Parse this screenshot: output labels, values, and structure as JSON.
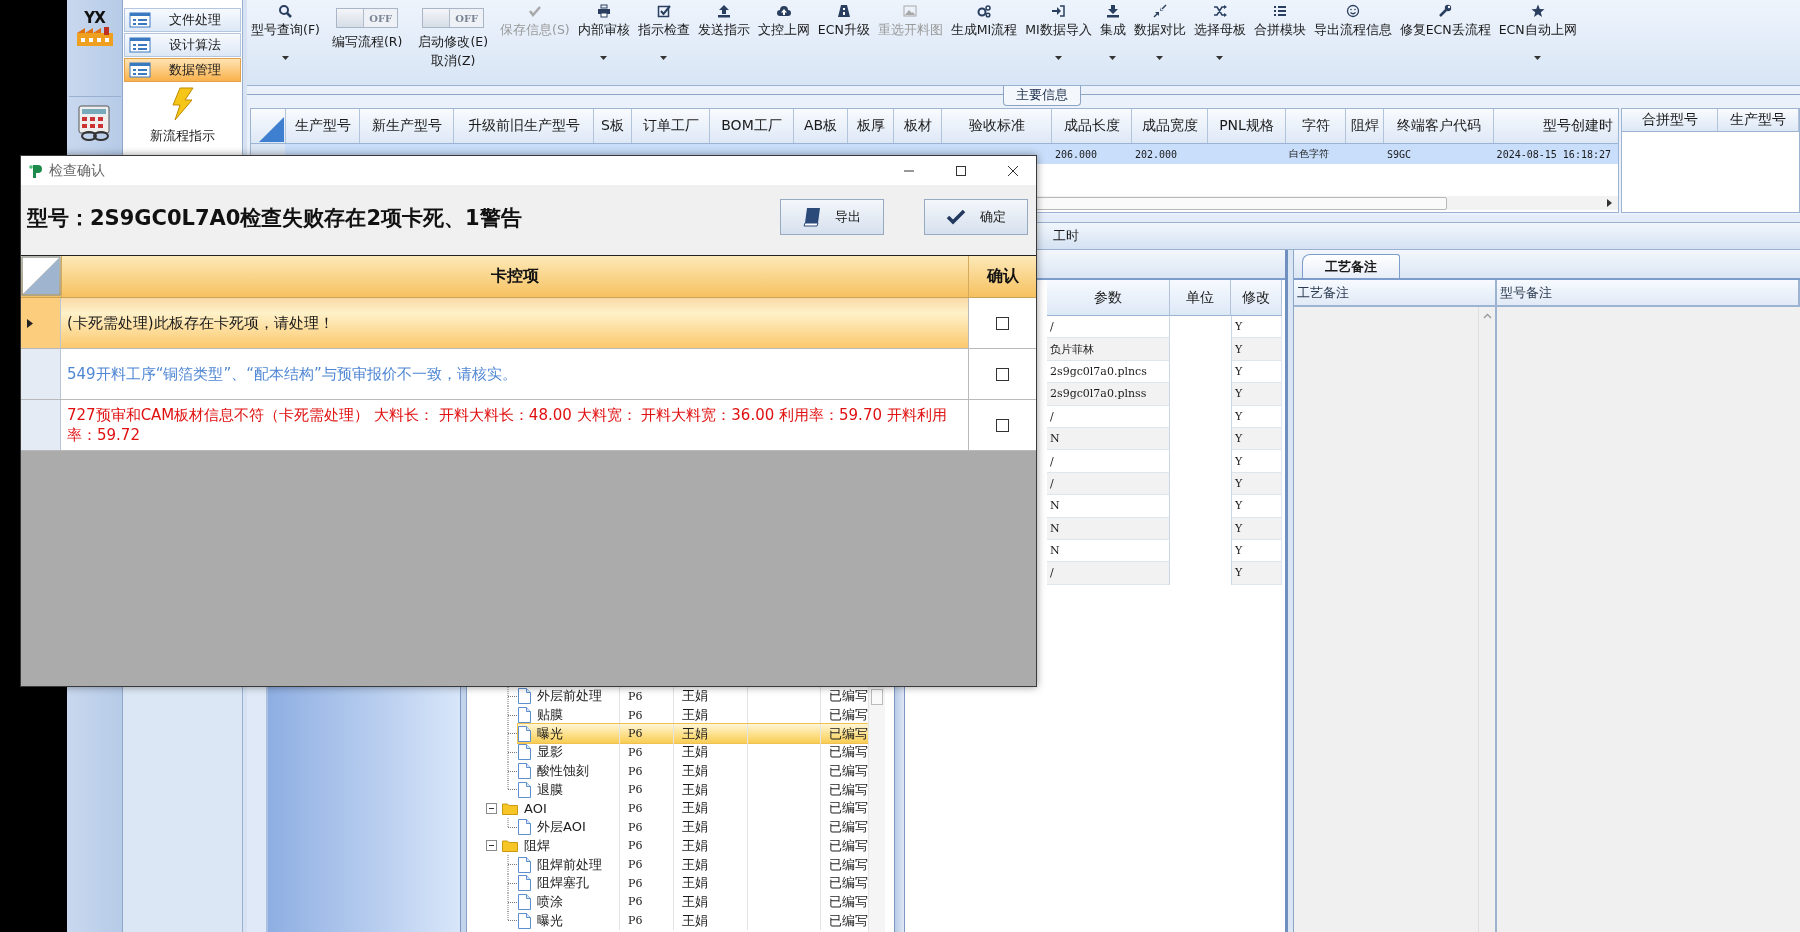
{
  "sidebar": {
    "logo": "YX",
    "nav": [
      {
        "label": "文件处理",
        "selected": false
      },
      {
        "label": "设计算法",
        "selected": false
      },
      {
        "label": "数据管理",
        "selected": true
      }
    ],
    "shortcut": {
      "label": "新流程指示"
    }
  },
  "toolbar": [
    {
      "kind": "button",
      "label": "型号查询(F)",
      "disabled": false,
      "dropdown": true
    },
    {
      "kind": "toggle",
      "switch_text": "OFF",
      "on": false,
      "label": "编写流程(R)"
    },
    {
      "kind": "toggle",
      "switch_text": "OFF",
      "on": false,
      "label": "启动修改(E)",
      "second_label": "取消(Z)"
    },
    {
      "kind": "button",
      "label": "保存信息(S)",
      "disabled": true,
      "dropdown": false
    },
    {
      "kind": "button",
      "label": "内部审核",
      "disabled": false,
      "dropdown": true
    },
    {
      "kind": "button",
      "label": "指示检查",
      "disabled": false,
      "dropdown": true
    },
    {
      "kind": "button",
      "label": "发送指示",
      "disabled": false,
      "dropdown": false
    },
    {
      "kind": "button",
      "label": "文控上网",
      "disabled": false,
      "dropdown": false
    },
    {
      "kind": "button",
      "label": "ECN升级",
      "disabled": false,
      "dropdown": false
    },
    {
      "kind": "button",
      "label": "重选开料图",
      "disabled": true,
      "dropdown": false
    },
    {
      "kind": "button",
      "label": "生成MI流程",
      "disabled": false,
      "dropdown": false
    },
    {
      "kind": "button",
      "label": "MI数据导入",
      "disabled": false,
      "dropdown": true
    },
    {
      "kind": "button",
      "label": "集成",
      "disabled": false,
      "dropdown": true
    },
    {
      "kind": "button",
      "label": "数据对比",
      "disabled": false,
      "dropdown": true
    },
    {
      "kind": "button",
      "label": "选择母板",
      "disabled": false,
      "dropdown": true
    },
    {
      "kind": "button",
      "label": "合拼模块",
      "disabled": false,
      "dropdown": false
    },
    {
      "kind": "button",
      "label": "导出流程信息",
      "disabled": false,
      "dropdown": false
    },
    {
      "kind": "button",
      "label": "修复ECN丢流程",
      "disabled": false,
      "dropdown": false
    },
    {
      "kind": "button",
      "label": "ECN自动上网",
      "disabled": false,
      "dropdown": true
    }
  ],
  "main_info": {
    "title": "主要信息",
    "columns": [
      "生产型号",
      "新生产型号",
      "升级前旧生产型号",
      "S板",
      "订单工厂",
      "BOM工厂",
      "AB板",
      "板厚",
      "板材",
      "验收标准",
      "成品长度",
      "成品宽度",
      "PNL规格",
      "字符",
      "阻焊",
      "终端客户代码",
      "型号创建时"
    ],
    "rows": [
      {
        "selected": true,
        "cells": [
          null,
          null,
          null,
          null,
          null,
          null,
          null,
          null,
          null,
          null,
          "206.000",
          "202.000",
          null,
          "白色字符",
          null,
          "S9GC",
          "2024-08-15 16:18:27"
        ]
      }
    ]
  },
  "merge_grid": {
    "columns": [
      "合拼型号",
      "生产型号"
    ]
  },
  "hours_tab": {
    "label": "工时"
  },
  "params": {
    "columns": [
      "参数",
      "单位",
      "修改"
    ],
    "rows": [
      {
        "value": "/",
        "modified": "Y"
      },
      {
        "value": "负片菲林",
        "modified": "Y"
      },
      {
        "value": "2s9gc0l7a0.plncs",
        "modified": "Y"
      },
      {
        "value": "2s9gc0l7a0.plnss",
        "modified": "Y"
      },
      {
        "value": "/",
        "modified": "Y"
      },
      {
        "value": "N",
        "modified": "Y"
      },
      {
        "value": "/",
        "modified": "Y"
      },
      {
        "value": "/",
        "modified": "Y"
      },
      {
        "value": "N",
        "modified": "Y"
      },
      {
        "value": "N",
        "modified": "Y"
      },
      {
        "value": "N",
        "modified": "Y"
      },
      {
        "value": "/",
        "modified": "Y"
      }
    ]
  },
  "notes": {
    "tab": {
      "label": "工艺备注",
      "selected": true
    },
    "columns": [
      "工艺备注",
      "型号备注"
    ]
  },
  "process_tree": {
    "rows": [
      {
        "kind": "step",
        "name": "外层前处理",
        "column_2": "P6",
        "column_3": "王娟",
        "column_5": "已编写",
        "selected": false
      },
      {
        "kind": "step",
        "name": "贴膜",
        "column_2": "P6",
        "column_3": "王娟",
        "column_5": "已编写",
        "selected": false
      },
      {
        "kind": "step",
        "name": "曝光",
        "column_2": "P6",
        "column_3": "王娟",
        "column_5": "已编写",
        "selected": true
      },
      {
        "kind": "step",
        "name": "显影",
        "column_2": "P6",
        "column_3": "王娟",
        "column_5": "已编写",
        "selected": false
      },
      {
        "kind": "step",
        "name": "酸性蚀刻",
        "column_2": "P6",
        "column_3": "王娟",
        "column_5": "已编写",
        "selected": false
      },
      {
        "kind": "step",
        "name": "退膜",
        "column_2": "P6",
        "column_3": "王娟",
        "column_5": "已编写",
        "selected": false
      },
      {
        "kind": "group",
        "name": "AOI",
        "column_2": "P6",
        "column_3": "王娟",
        "column_5": "已编写",
        "selected": false,
        "expanded": true,
        "children": [
          {
            "kind": "step",
            "name": "外层AOI",
            "column_2": "P6",
            "column_3": "王娟",
            "column_5": "已编写",
            "selected": false
          }
        ]
      },
      {
        "kind": "group",
        "name": "阻焊",
        "column_2": "P6",
        "column_3": "王娟",
        "column_5": "已编写",
        "selected": false,
        "expanded": true,
        "children": [
          {
            "kind": "step",
            "name": "阻焊前处理",
            "column_2": "P6",
            "column_3": "王娟",
            "column_5": "已编写",
            "selected": false
          },
          {
            "kind": "step",
            "name": "阻焊塞孔",
            "column_2": "P6",
            "column_3": "王娟",
            "column_5": "已编写",
            "selected": false
          },
          {
            "kind": "step",
            "name": "喷涂",
            "column_2": "P6",
            "column_3": "王娟",
            "column_5": "已编写",
            "selected": false
          },
          {
            "kind": "step",
            "name": "曝光",
            "column_2": "P6",
            "column_3": "王娟",
            "column_5": "已编写",
            "selected": false
          }
        ]
      }
    ]
  },
  "dialog": {
    "title": "检查确认",
    "heading": "型号：2S9GC0L7A0检查失败存在2项卡死、1警告",
    "buttons": [
      {
        "label": "导出"
      },
      {
        "label": "确定"
      }
    ],
    "columns": [
      "卡控项",
      "确认"
    ],
    "rows": [
      {
        "text": "(卡死需处理)此板存在卡死项，请处理！",
        "color": "#1a1a1a",
        "selected": true,
        "checked": false
      },
      {
        "text": "549开料工序“铜箔类型”、“配本结构”与预审报价不一致，请核实。",
        "color": "#4f86d4",
        "selected": false,
        "checked": false
      },
      {
        "text": "727预审和CAM板材信息不符（卡死需处理） 大料长： 开料大料长：48.00 大料宽： 开料大料宽：36.00 利用率：59.70 开料利用率：59.72",
        "color": "#e01010",
        "selected": false,
        "checked": false
      }
    ]
  }
}
